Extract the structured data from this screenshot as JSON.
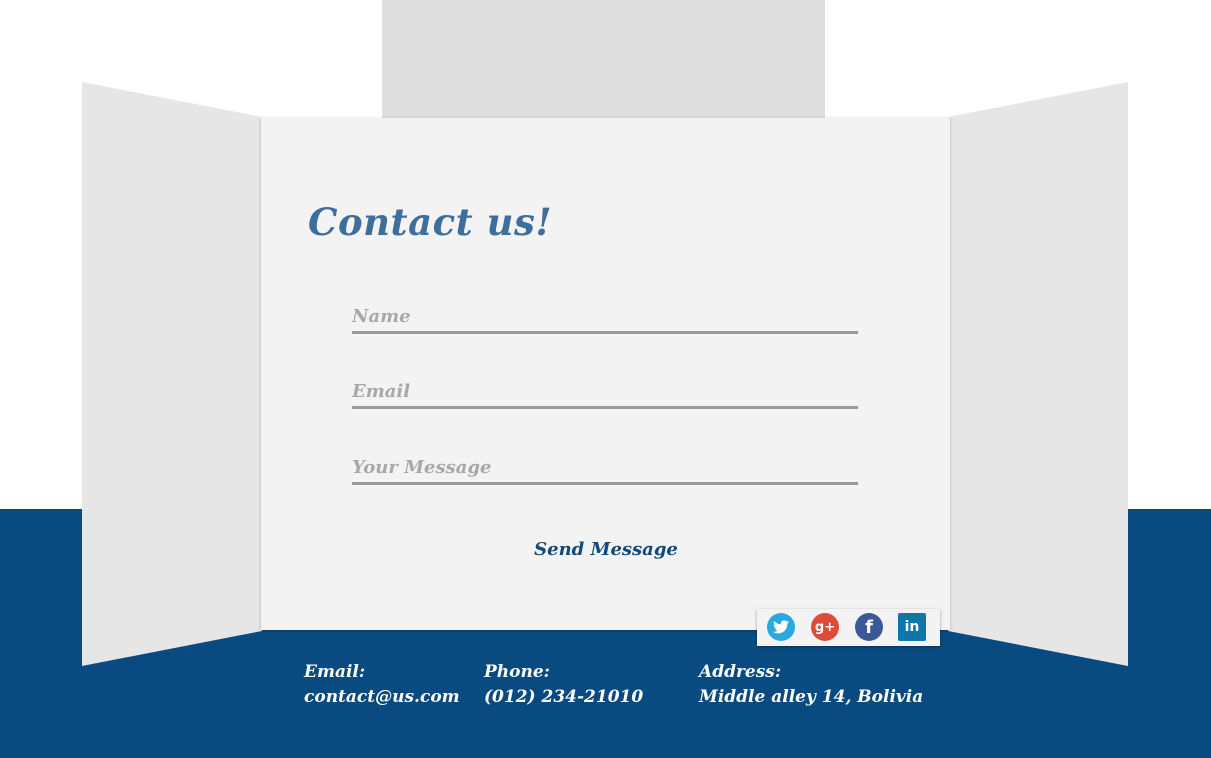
{
  "contact": {
    "title": "Contact us!",
    "name_placeholder": "Name",
    "email_placeholder": "Email",
    "message_placeholder": "Your Message",
    "send_label": "Send Message"
  },
  "social": {
    "icons": [
      "twitter-icon",
      "google-plus-icon",
      "facebook-icon",
      "linkedin-icon"
    ],
    "colors": {
      "twitter": "#2aa9e0",
      "google_plus": "#dd4b39",
      "facebook": "#3b5998",
      "linkedin": "#0e76a8"
    }
  },
  "footer": {
    "email_label": "Email:",
    "email_value": "contact@us.com",
    "phone_label": "Phone:",
    "phone_value": "(012) 234-21010",
    "address_label": "Address:",
    "address_value": "Middle alley 14, Bolivia"
  },
  "colors": {
    "accent": "#094b80",
    "title": "#3e6f9c",
    "card": "#f3f3f3",
    "panel": "#e6e6e6"
  }
}
